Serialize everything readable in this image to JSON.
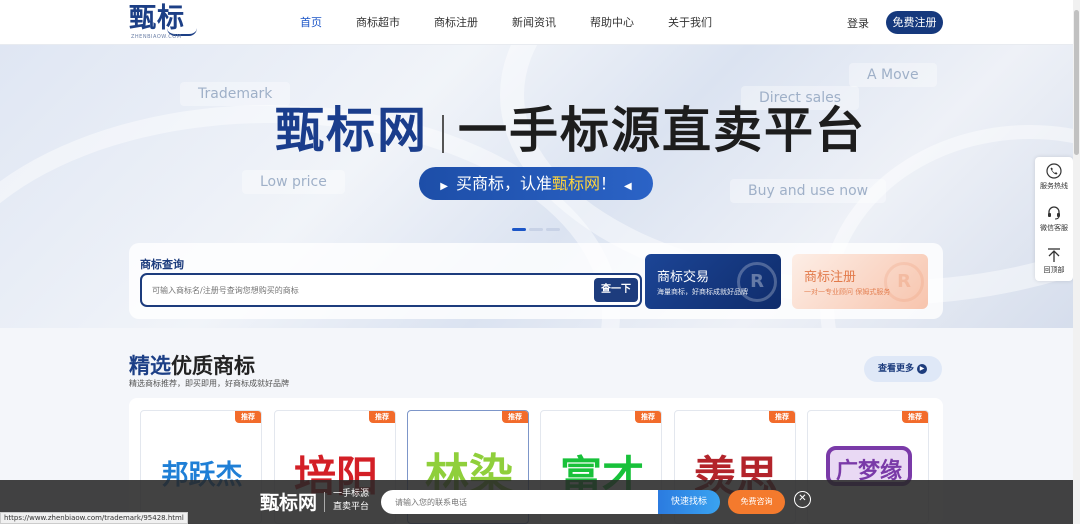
{
  "header": {
    "logo_text": "甄标",
    "logo_sub": "ZHENBIAOW.COM",
    "nav": [
      "首页",
      "商标超市",
      "商标注册",
      "新闻资讯",
      "帮助中心",
      "关于我们"
    ],
    "login": "登录",
    "register": "免费注册",
    "accent": "#1c3f86"
  },
  "hero": {
    "tags": [
      "Trademark",
      "A Move",
      "Direct sales",
      "Low price",
      "Buy and use now"
    ],
    "title_brand": "甄标网",
    "title_main": "一手标源直卖平台",
    "banner_prefix": "买商标，认准",
    "banner_highlight": "甄标网",
    "banner_suffix": "！",
    "slides": 3,
    "active_slide": 1
  },
  "search": {
    "label": "商标查询",
    "placeholder": "可输入商标名/注册号查询您想购买的商标",
    "button": "查一下"
  },
  "cards": {
    "trade_title": "商标交易",
    "trade_sub": "海量商标，好商标成就好品牌",
    "reg_title": "商标注册",
    "reg_sub": "一对一专业顾问 保姆式服务",
    "r_mark": "R"
  },
  "side_tools": [
    {
      "label": "服务热线",
      "icon": "phone-icon"
    },
    {
      "label": "微信客服",
      "icon": "headset-icon"
    },
    {
      "label": "回顶部",
      "icon": "arrow-up-icon"
    }
  ],
  "section": {
    "title_hl": "精选",
    "title_rest": "优质商标",
    "subtitle": "精选商标推荐，即买即用，好商标成就好品牌",
    "more": "查看更多",
    "badge": "推荐",
    "trademarks": [
      {
        "name": "邦跃杰",
        "color": "#1f7fd6"
      },
      {
        "name": "培阳",
        "color": "#d31f26"
      },
      {
        "name": "林染",
        "color": "#8fcf3b"
      },
      {
        "name": "富才",
        "color": "#18c13a"
      },
      {
        "name": "羡思",
        "color": "#b3242b"
      },
      {
        "name": "广梦缘",
        "color": "#7a3aa8"
      }
    ]
  },
  "bottom_bar": {
    "logo": "甄标网",
    "slogan_line1": "一手标源",
    "slogan_line2": "直卖平台",
    "placeholder": "请输入您的联系电话",
    "search_btn": "快速找标",
    "consult_btn": "免费咨询",
    "close": "✕"
  },
  "status_url": "https://www.zhenbiaow.com/trademark/95428.html"
}
